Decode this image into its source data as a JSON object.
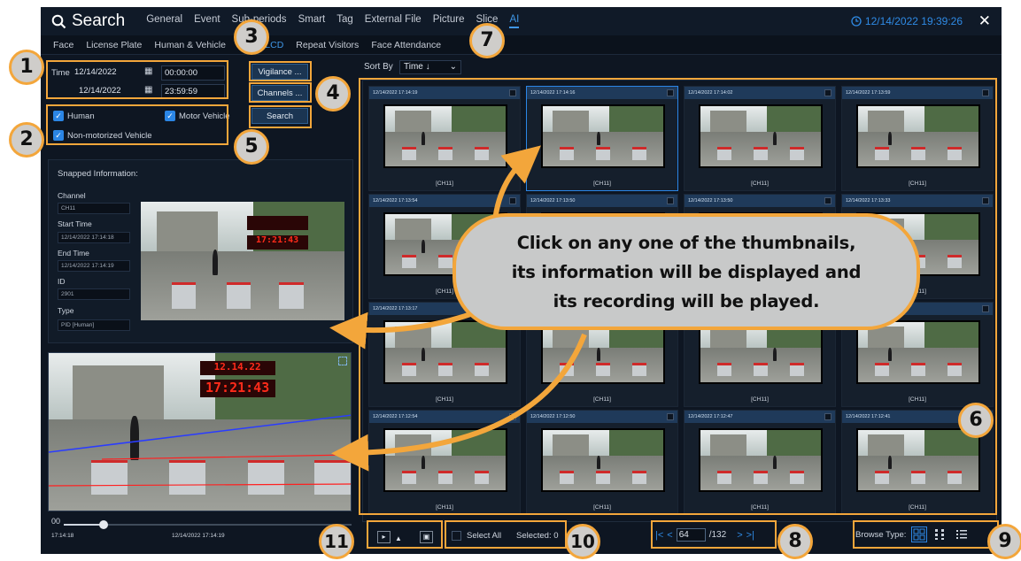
{
  "topbar": {
    "search_label": "Search",
    "menu": [
      "General",
      "Event",
      "Sub-periods",
      "Smart",
      "Tag",
      "External File",
      "Picture",
      "Slice",
      "AI"
    ],
    "active_menu": "AI",
    "clock": "12/14/2022 19:39:26",
    "close": "✕"
  },
  "subbar": {
    "tabs": [
      "Face",
      "License Plate",
      "Human & Vehicle",
      "PID & LCD",
      "Repeat Visitors",
      "Face Attendance"
    ],
    "active_tab": "PID & LCD"
  },
  "filters": {
    "time_label": "Time",
    "start_date": "12/14/2022",
    "start_time": "00:00:00",
    "end_date": "12/14/2022",
    "end_time": "23:59:59",
    "human_label": "Human",
    "motor_label": "Motor Vehicle",
    "nonmotor_label": "Non-motorized Vehicle",
    "vigilance_label": "Vigilance ...",
    "channels_label": "Channels ...",
    "search_label": "Search"
  },
  "snapped": {
    "title": "Snapped Information:",
    "channel_label": "Channel",
    "channel_value": "CH11",
    "start_label": "Start Time",
    "start_value": "12/14/2022 17:14:18",
    "end_label": "End Time",
    "end_value": "12/14/2022 17:14:19",
    "id_label": "ID",
    "id_value": "2901",
    "type_label": "Type",
    "type_value": "PID [Human]",
    "preview_clock": "17:21:43"
  },
  "player": {
    "clock_big": "17:21:43",
    "clock_small": "12.14.22",
    "time_start": "17:14:18",
    "time_mid": "12/14/2022 17:14:19",
    "loop_icon": "00"
  },
  "sort": {
    "label": "Sort By",
    "value": "Time ↓"
  },
  "thumbnails": [
    {
      "time": "12/14/2022 17:14:19",
      "channel": "[CH11]"
    },
    {
      "time": "12/14/2022 17:14:16",
      "channel": "[CH11]"
    },
    {
      "time": "12/14/2022 17:14:02",
      "channel": "[CH11]"
    },
    {
      "time": "12/14/2022 17:13:59",
      "channel": "[CH11]"
    },
    {
      "time": "12/14/2022 17:13:54",
      "channel": "[CH11]"
    },
    {
      "time": "12/14/2022 17:13:50",
      "channel": "[CH11]"
    },
    {
      "time": "12/14/2022 17:13:50",
      "channel": "[CH11]"
    },
    {
      "time": "12/14/2022 17:13:33",
      "channel": "[CH11]"
    },
    {
      "time": "12/14/2022 17:13:17",
      "channel": "[CH11]"
    },
    {
      "time": "",
      "channel": "[CH11]"
    },
    {
      "time": "",
      "channel": "[CH11]"
    },
    {
      "time": "",
      "channel": "[CH11]"
    },
    {
      "time": "12/14/2022 17:12:54",
      "channel": "[CH11]"
    },
    {
      "time": "12/14/2022 17:12:50",
      "channel": "[CH11]"
    },
    {
      "time": "12/14/2022 17:12:47",
      "channel": "[CH11]"
    },
    {
      "time": "12/14/2022 17:12:41",
      "channel": "[CH11]"
    }
  ],
  "bottom": {
    "select_all": "Select All",
    "selected": "Selected: 0",
    "page_value": "64",
    "page_total": "/132",
    "browse_type": "Browse Type:"
  },
  "callout": {
    "text": "Click on any one of the thumbnails,\nits information will be displayed and\nits recording will be played."
  },
  "badges": [
    "1",
    "2",
    "3",
    "4",
    "5",
    "6",
    "7",
    "8",
    "9",
    "10",
    "11"
  ],
  "colors": {
    "accent": "#2f8be6",
    "annotation": "#f3a63b",
    "background": "#0e1622"
  }
}
